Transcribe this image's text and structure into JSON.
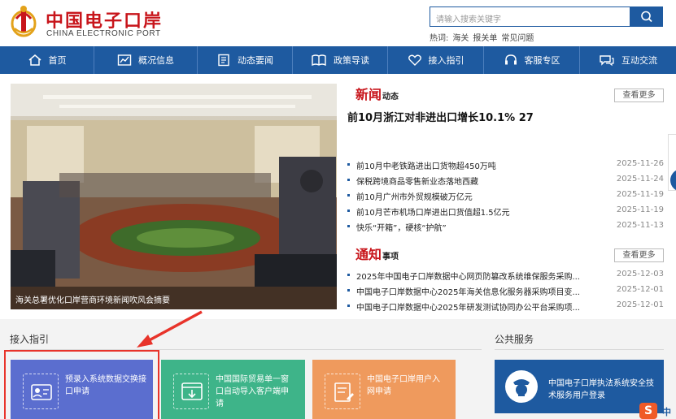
{
  "header": {
    "logo_cn": "中国电子口岸",
    "logo_en": "CHINA ELECTRONIC PORT",
    "search_placeholder": "请输入搜索关键字",
    "hot_label": "热词:",
    "hot_words": [
      "海关",
      "报关单",
      "常见问题"
    ]
  },
  "nav": [
    {
      "label": "首页",
      "icon": "home-icon"
    },
    {
      "label": "概况信息",
      "icon": "chart-icon"
    },
    {
      "label": "动态要闻",
      "icon": "document-icon"
    },
    {
      "label": "政策导读",
      "icon": "book-icon"
    },
    {
      "label": "接入指引",
      "icon": "heart-icon"
    },
    {
      "label": "客服专区",
      "icon": "headset-icon"
    },
    {
      "label": "互动交流",
      "icon": "chat-icon"
    }
  ],
  "banner": {
    "caption": "海关总署优化口岸营商环境新闻吹风会摘要"
  },
  "news": {
    "title_big": "新闻",
    "title_small": "动态",
    "more": "查看更多",
    "headline": "前10月浙江对非进出口增长10.1% 27",
    "items": [
      {
        "title": "前10月中老铁路进出口货物超450万吨",
        "date": "2025-11-26"
      },
      {
        "title": "保税跨境商品零售新业态落地西藏",
        "date": "2025-11-24"
      },
      {
        "title": "前10月广州市外贸规模破万亿元",
        "date": "2025-11-19"
      },
      {
        "title": "前10月芒市机场口岸进出口货值超1.5亿元",
        "date": "2025-11-19"
      },
      {
        "title": "快乐“开箱”，硬核“护航”",
        "date": "2025-11-13"
      }
    ]
  },
  "notice": {
    "title_big": "通知",
    "title_small": "事项",
    "more": "查看更多",
    "items": [
      {
        "title": "2025年中国电子口岸数据中心网页防篡改系统维保服务采购...",
        "date": "2025-12-03"
      },
      {
        "title": "中国电子口岸数据中心2025年海关信息化服务器采购项目变...",
        "date": "2025-12-01"
      },
      {
        "title": "中国电子口岸数据中心2025年研发测试协同办公平台采购项...",
        "date": "2025-12-01"
      }
    ]
  },
  "access": {
    "label": "接入指引",
    "cards": [
      {
        "text": "预录入系统数据交换接口申请",
        "color": "#5b6ecf",
        "icon": "id-card-icon"
      },
      {
        "text": "中国国际贸易单一窗口自动导入客户端申请",
        "color": "#3eb489",
        "icon": "download-window-icon"
      },
      {
        "text": "中国电子口岸用户入网申请",
        "color": "#ef9a5d",
        "icon": "signup-form-icon"
      }
    ]
  },
  "public": {
    "label": "公共服务",
    "service": "中国电子口岸执法系统安全技术服务用户登录",
    "icon": "officer-badge-icon"
  },
  "colors": {
    "brand_red": "#c8151b",
    "nav_blue": "#1e5aa0",
    "highlight_red": "#e8332a"
  },
  "widgets": {
    "ime_logo": "S",
    "ime_lang": "中"
  }
}
